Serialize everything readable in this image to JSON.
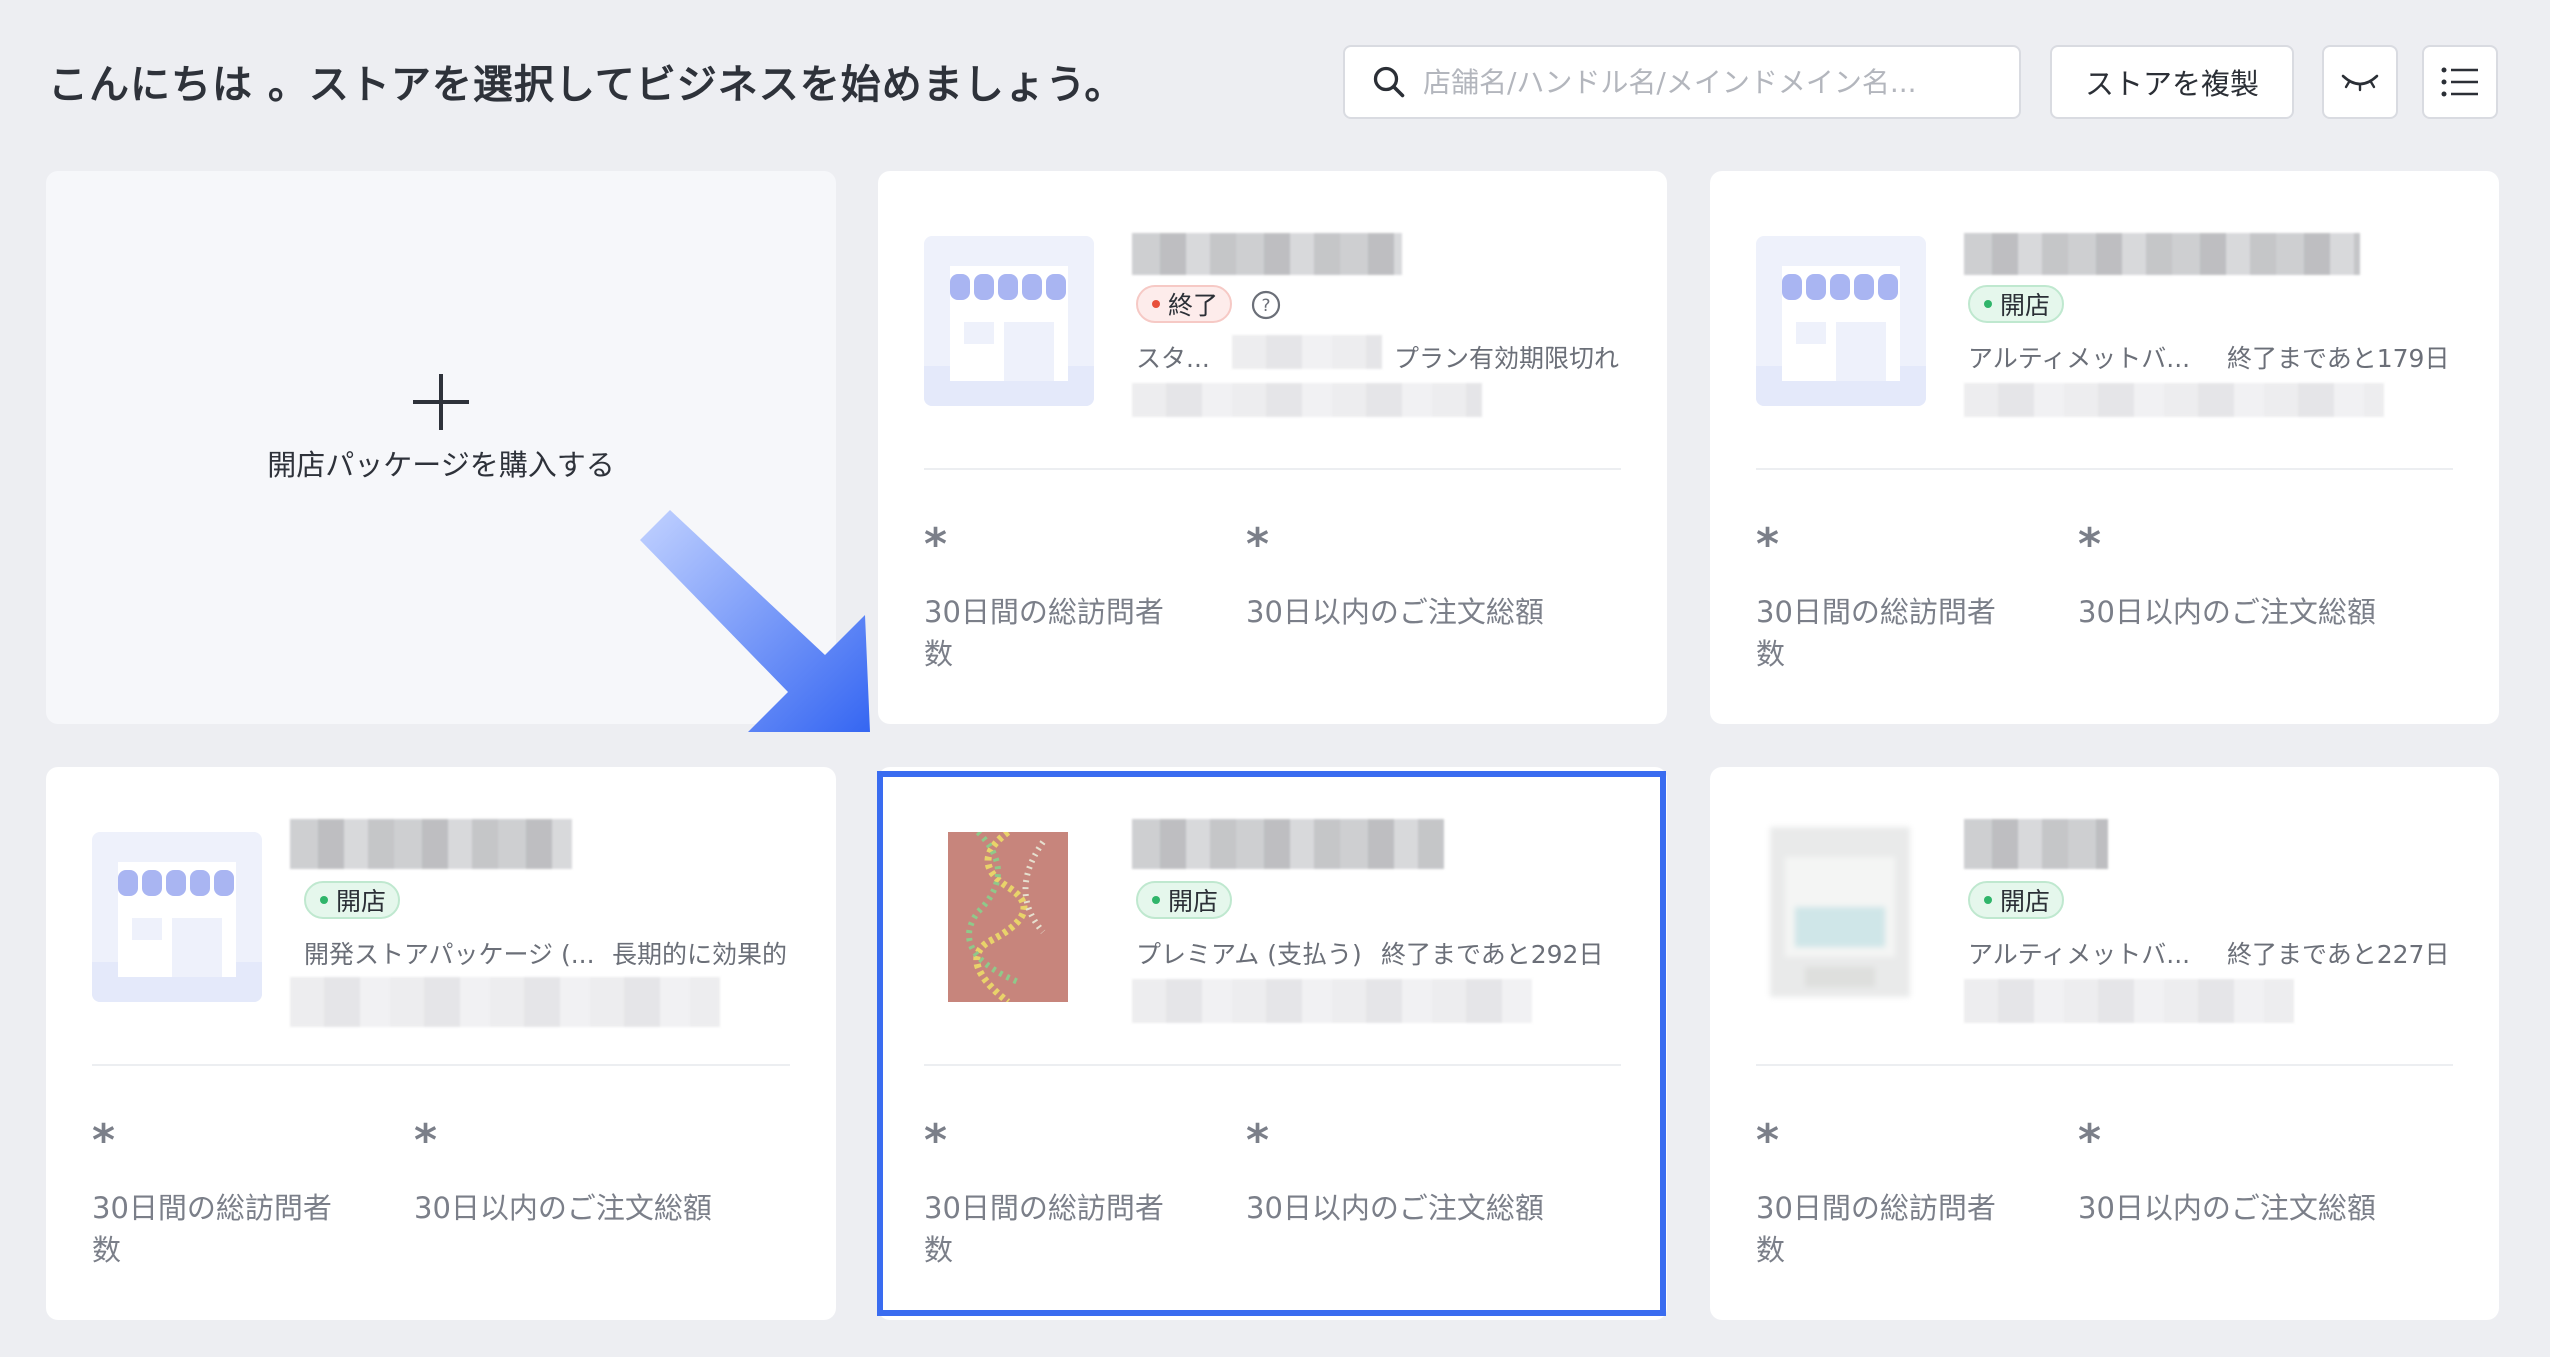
{
  "header": {
    "greeting": "こんにちは 。ストアを選択してビジネスを始めましょう。",
    "search_placeholder": "店舗名/ハンドル名/メインドメイン名...",
    "duplicate_label": "ストアを複製"
  },
  "add_card": {
    "label": "開店パッケージを購入する"
  },
  "stat_labels": {
    "visitors": "30日間の総訪問者数",
    "orders": "30日以内のご注文総額"
  },
  "stores": [
    {
      "status": "終了",
      "status_type": "ended",
      "plan": "スタ...",
      "expiry": "プラン有効期限切れ",
      "visitors": "*",
      "orders": "*",
      "logo": "placeholder"
    },
    {
      "status": "開店",
      "status_type": "open",
      "plan": "アルティメットバ...",
      "expiry": "終了まであと179日",
      "visitors": "*",
      "orders": "*",
      "logo": "placeholder"
    },
    {
      "status": "開店",
      "status_type": "open",
      "plan": "開発ストアパッケージ (...",
      "expiry": "長期的に効果的",
      "visitors": "*",
      "orders": "*",
      "logo": "placeholder"
    },
    {
      "status": "開店",
      "status_type": "open",
      "plan": "プレミアム (支払う)",
      "expiry": "終了まであと292日",
      "visitors": "*",
      "orders": "*",
      "logo": "photo",
      "selected": true
    },
    {
      "status": "開店",
      "status_type": "open",
      "plan": "アルティメットバ...",
      "expiry": "終了まであと227日",
      "visitors": "*",
      "orders": "*",
      "logo": "blurred"
    }
  ],
  "colors": {
    "accent": "#3a6cf0",
    "open_dot": "#2fb56a",
    "ended_dot": "#e8503a"
  }
}
